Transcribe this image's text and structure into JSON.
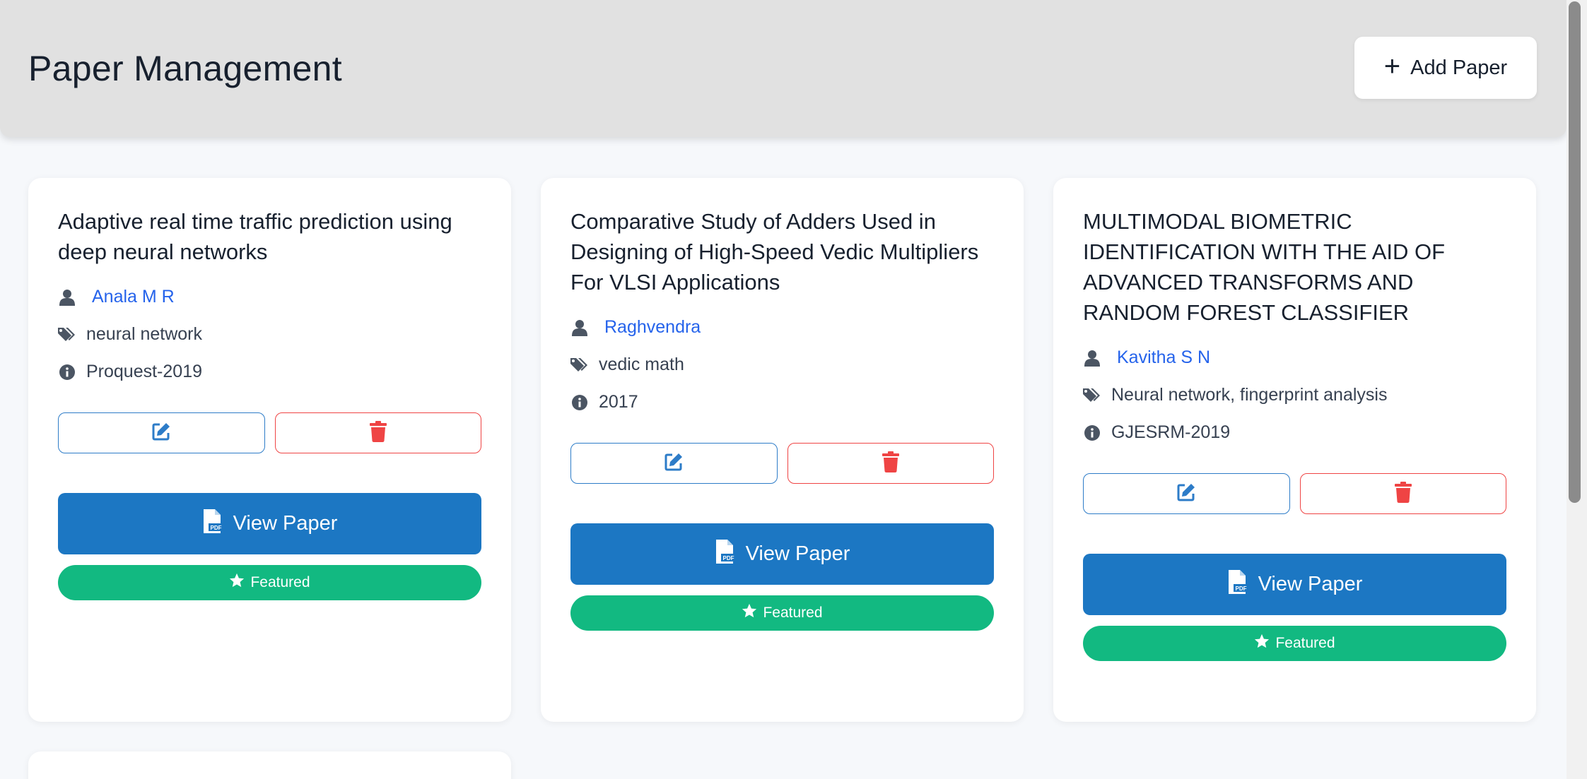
{
  "header": {
    "title": "Paper Management",
    "add_button_label": "Add Paper"
  },
  "papers": [
    {
      "title": "Adaptive real time traffic prediction using deep neural networks",
      "author": "Anala M R",
      "tags": "neural network",
      "info": "Proquest-2019",
      "view_label": "View Paper",
      "featured_label": "Featured"
    },
    {
      "title": "Comparative Study of Adders Used in Designing of High-Speed Vedic Multipliers For VLSI Applications",
      "author": "Raghvendra",
      "tags": "vedic math",
      "info": "2017",
      "view_label": "View Paper",
      "featured_label": "Featured"
    },
    {
      "title": "MULTIMODAL BIOMETRIC IDENTIFICATION WITH THE AID OF ADVANCED TRANSFORMS AND RANDOM FOREST CLASSIFIER",
      "author": "Kavitha S N",
      "tags": "Neural network, fingerprint analysis",
      "info": "GJESRM-2019",
      "view_label": "View Paper",
      "featured_label": "Featured"
    }
  ],
  "icons": {
    "author": "user-icon",
    "tags": "tags-icon",
    "info": "info-circle-icon",
    "edit": "edit-icon",
    "delete": "trash-icon",
    "view": "file-pdf-icon",
    "featured": "star-icon",
    "add": "plus-icon"
  },
  "colors": {
    "primary": "#1c77c3",
    "featured": "#12b981",
    "danger": "#ef4444",
    "link": "#2563eb",
    "header_bg": "#e1e1e1"
  }
}
